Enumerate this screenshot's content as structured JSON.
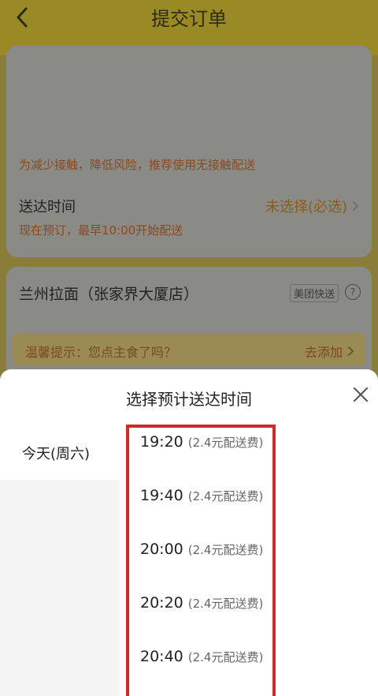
{
  "header": {
    "title": "提交订单",
    "back_icon": "back-arrow-icon"
  },
  "order": {
    "contactless_tip": "为减少接触，降低风险，推荐使用无接触配送",
    "delivery_label": "送达时间",
    "delivery_value": "未选择(必选)",
    "delivery_sub": "现在预订，最早10:00开始配送",
    "shop_name": "兰州拉面（张家界大厦店）",
    "delivery_badge": "美团快送",
    "help_icon": "question-circle-icon",
    "warm_tip": "温馨提示：您点主食了吗？",
    "add_link": "去添加"
  },
  "sheet": {
    "title": "选择预计送达时间",
    "close_icon": "close-icon",
    "days": [
      {
        "label": "今天(周六)"
      }
    ],
    "times": [
      {
        "time": "19:20",
        "fee": "(2.4元配送费)"
      },
      {
        "time": "19:40",
        "fee": "(2.4元配送费)"
      },
      {
        "time": "20:00",
        "fee": "(2.4元配送费)"
      },
      {
        "time": "20:20",
        "fee": "(2.4元配送费)"
      },
      {
        "time": "20:40",
        "fee": "(2.4元配送费)"
      }
    ]
  },
  "colors": {
    "highlight_border": "#d12a2a",
    "accent_orange": "#8e5a16"
  }
}
